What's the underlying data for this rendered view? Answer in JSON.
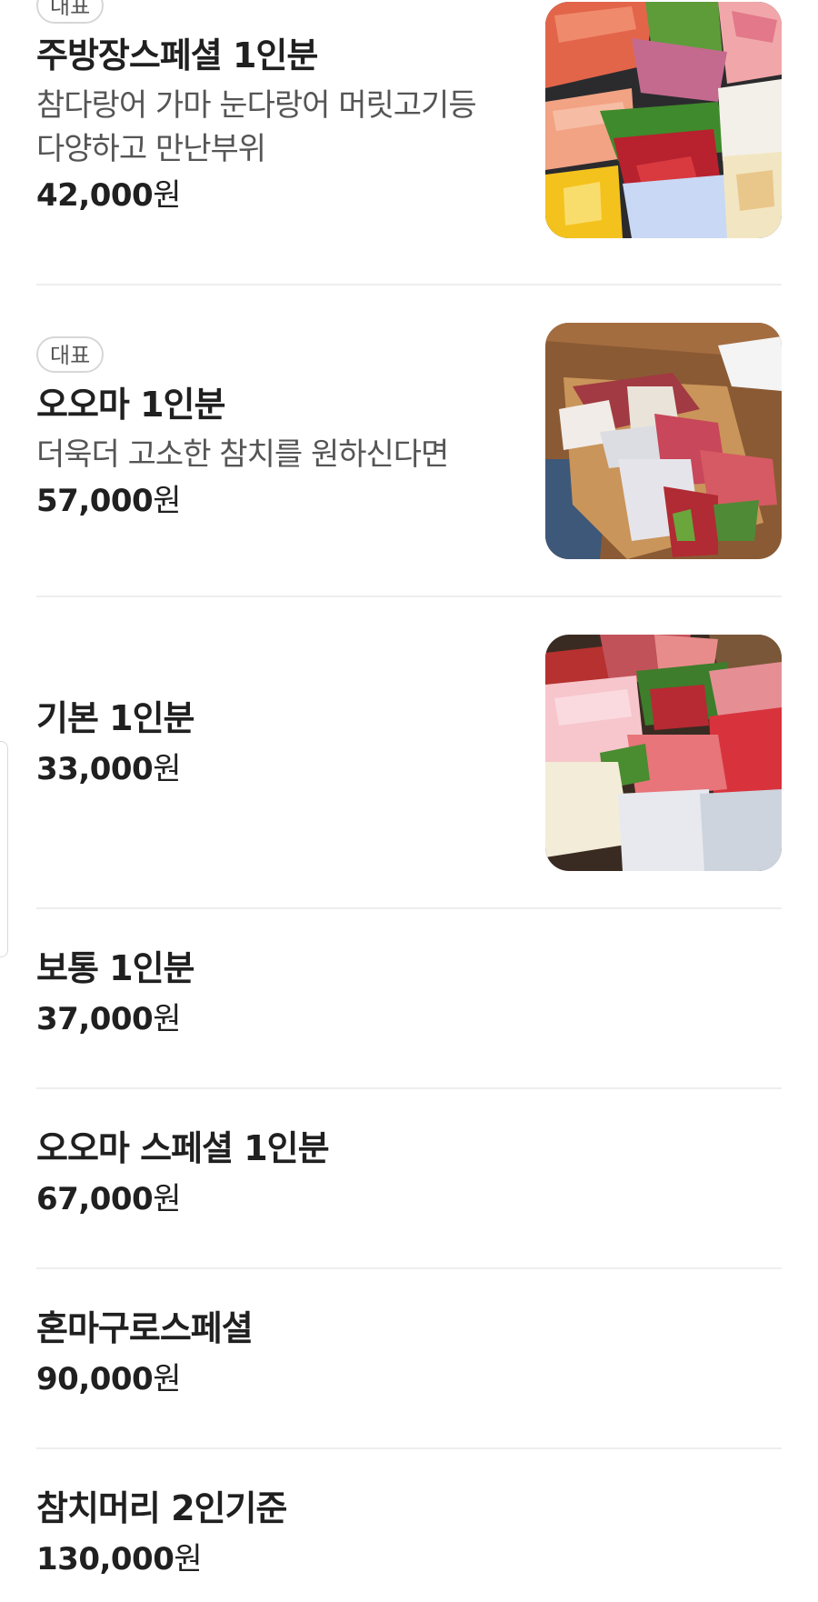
{
  "menu": {
    "items": [
      {
        "badge": "대표",
        "name": "주방장스페셜 1인분",
        "desc_lines": [
          "참다랑어 가마 눈다랑어 머릿고기등",
          "다양하고 만난부위"
        ],
        "price": "42,000",
        "currency": "원",
        "photo": "sashimi-platter-photo"
      },
      {
        "badge": "대표",
        "name": "오오마 1인분",
        "desc_lines": [
          "더욱더 고소한 참치를 원하신다면"
        ],
        "price": "57,000",
        "currency": "원",
        "photo": "tuna-on-wooden-board-photo"
      },
      {
        "name": "기본 1인분",
        "price": "33,000",
        "currency": "원",
        "photo": "tuna-sashimi-on-noodles-photo"
      },
      {
        "name": "보통 1인분",
        "price": "37,000",
        "currency": "원"
      },
      {
        "name": "오오마 스페셜 1인분",
        "price": "67,000",
        "currency": "원"
      },
      {
        "name": "혼마구로스페셜",
        "price": "90,000",
        "currency": "원"
      },
      {
        "name": "참치머리 2인기준",
        "price": "130,000",
        "currency": "원"
      }
    ]
  }
}
